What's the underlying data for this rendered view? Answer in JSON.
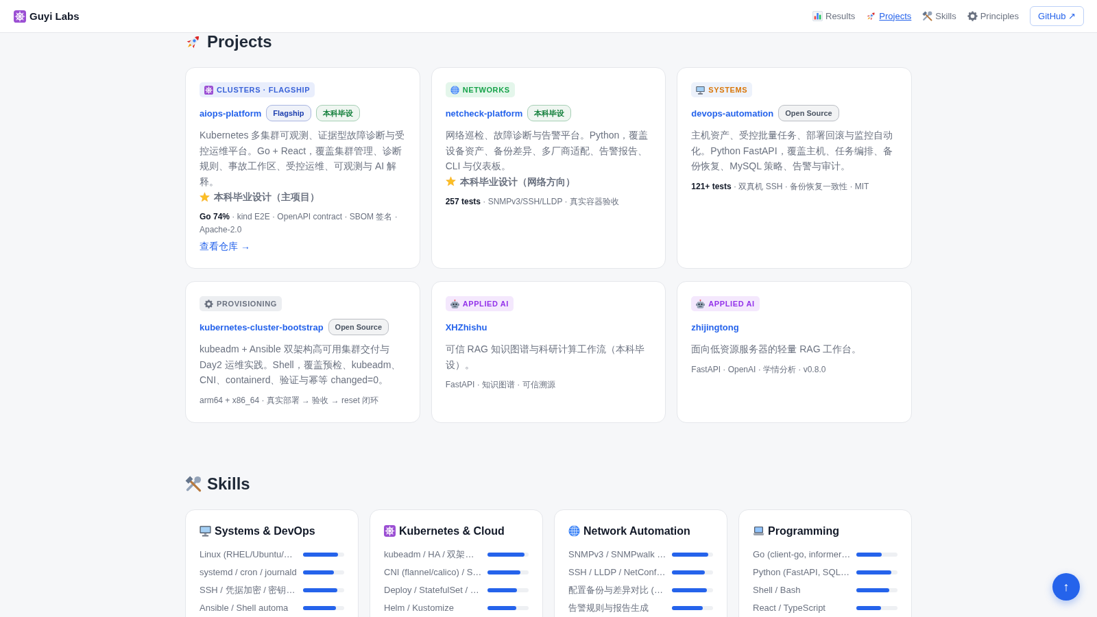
{
  "header": {
    "logo": "Guyi Labs",
    "nav": [
      {
        "kind": "results",
        "label": "Results",
        "selected": false
      },
      {
        "kind": "projects",
        "label": "Projects",
        "selected": true
      },
      {
        "kind": "skills",
        "label": "Skills",
        "selected": false
      },
      {
        "kind": "principles",
        "label": "Principles",
        "selected": false
      }
    ],
    "github": "GitHub ↗"
  },
  "projects": {
    "title": "Projects",
    "cards": [
      {
        "kind": "clusters",
        "category": "CLUSTERS · FLAGSHIP",
        "color": "#3a63d8",
        "name": "aiops-platform",
        "badges": [
          {
            "label": "Flagship",
            "color": "#1e40af"
          },
          {
            "label": "本科毕设",
            "color": "#15803d"
          }
        ],
        "description": "Kubernetes 多集群可观测、证据型故障诊断与受控运维平台。Go + React，覆盖集群管理、诊断规则、事故工作区、受控运维、可观测与 AI 解释。",
        "note": "本科毕业设计（主项目）",
        "meta": "**Go 74%** · kind E2E · OpenAPI contract · SBOM 签名 · Apache-2.0",
        "link": "查看仓库 →"
      },
      {
        "kind": "networks",
        "category": "NETWORKS",
        "color": "#17a34a",
        "name": "netcheck-platform",
        "badges": [
          {
            "label": "本科毕设",
            "color": "#15803d"
          }
        ],
        "description": "网络巡检、故障诊断与告警平台。Python，覆盖设备资产、备份差异、多厂商适配、告警报告、CLI 与仪表板。",
        "note": "本科毕业设计（网络方向）",
        "meta": "**257 tests** · SNMPv3/SSH/LLDP · 真实容器验收"
      },
      {
        "kind": "systems",
        "category": "SYSTEMS",
        "color": "#d9770a",
        "name": "devops-automation",
        "badges": [
          {
            "label": "Open Source",
            "color": "#4b5563"
          }
        ],
        "description": "主机资产、受控批量任务、部署回滚与监控自动化。Python FastAPI，覆盖主机、任务编排、备份恢复、MySQL 策略、告警与审计。",
        "meta": "**121+ tests** · 双真机 SSH · 备份恢复一致性 · MIT"
      },
      {
        "kind": "provisioning",
        "category": "PROVISIONING",
        "color": "#6b7280",
        "name": "kubernetes-cluster-bootstrap",
        "badges": [
          {
            "label": "Open Source",
            "color": "#4b5563"
          }
        ],
        "description": "kubeadm + Ansible 双架构高可用集群交付与 Day2 运维实践。Shell，覆盖预检、kubeadm、CNI、containerd、验证与幂等 changed=0。",
        "meta": "arm64 + x86_64 · 真实部署 → 验收 → reset 闭环"
      },
      {
        "kind": "ai",
        "category": "APPLIED AI",
        "color": "#9333ea",
        "name": "XHZhishu",
        "description": "可信 RAG 知识图谱与科研计算工作流（本科毕设）。",
        "meta": "FastAPI · 知识图谱 · 可信溯源"
      },
      {
        "kind": "ai",
        "category": "APPLIED AI",
        "color": "#9333ea",
        "name": "zhijingtong",
        "description": "面向低资源服务器的轻量 RAG 工作台。",
        "meta": "FastAPI · OpenAI · 学情分析 · v0.8.0"
      }
    ]
  },
  "skills": {
    "title": "Skills",
    "groups": [
      {
        "kind": "systems",
        "title": "Systems & DevOps",
        "items": [
          {
            "label": "Linux (RHEL/Ubuntu/…",
            "level": 0.85
          },
          {
            "label": "systemd / cron / journald",
            "level": 0.75
          },
          {
            "label": "SSH / 凭据加密 / 密钥…",
            "level": 0.83
          },
          {
            "label": "Ansible / Shell automa",
            "level": 0.8
          }
        ]
      },
      {
        "kind": "kubernetes",
        "title": "Kubernetes & Cloud",
        "items": [
          {
            "label": "kubeadm / HA / 双架…",
            "level": 0.9
          },
          {
            "label": "CNI (flannel/calico) / S…",
            "level": 0.8
          },
          {
            "label": "Deploy / StatefulSet / …",
            "level": 0.72
          },
          {
            "label": "Helm / Kustomize",
            "level": 0.7
          }
        ]
      },
      {
        "kind": "network",
        "title": "Network Automation",
        "items": [
          {
            "label": "SNMPv3 / SNMPwalk …",
            "level": 0.88
          },
          {
            "label": "SSH / LLDP / NetConf…",
            "level": 0.8
          },
          {
            "label": "配置备份与差异对比 (…",
            "level": 0.85
          },
          {
            "label": "告警规则与报告生成",
            "level": 0.75
          }
        ]
      },
      {
        "kind": "programming",
        "title": "Programming",
        "items": [
          {
            "label": "Go (client-go, informer…",
            "level": 0.62
          },
          {
            "label": "Python (FastAPI, SQL…",
            "level": 0.85
          },
          {
            "label": "Shell / Bash",
            "level": 0.8
          },
          {
            "label": "React / TypeScript",
            "level": 0.6
          }
        ]
      }
    ]
  },
  "back_to_top": "↑"
}
